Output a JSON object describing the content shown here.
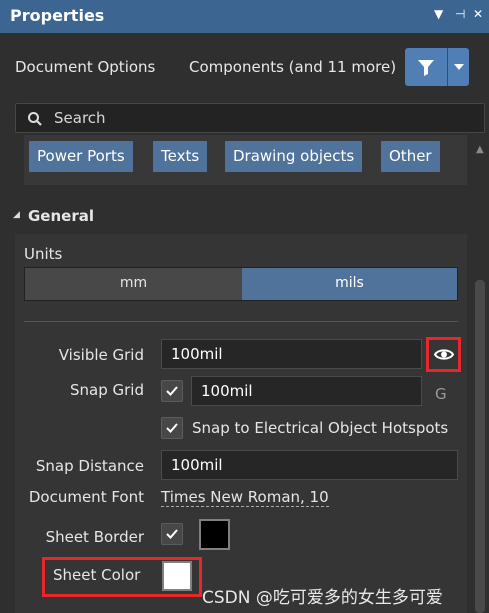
{
  "panel": {
    "title": "Properties",
    "title_buttons": [
      "▼",
      "⊣",
      "✕"
    ]
  },
  "tabs": {
    "document_options": "Document Options",
    "components": "Components (and 11 more)"
  },
  "search": {
    "placeholder": "Search"
  },
  "filters": [
    "Power Ports",
    "Texts",
    "Drawing objects",
    "Other"
  ],
  "general": {
    "heading": "General",
    "units_label": "Units",
    "units": {
      "mm": "mm",
      "mils": "mils",
      "selected": "mils"
    },
    "visible_grid_label": "Visible Grid",
    "visible_grid_value": "100mil",
    "snap_grid_label": "Snap Grid",
    "snap_grid_value": "100mil",
    "snap_grid_shortcut": "G",
    "snap_electrical_label": "Snap to Electrical Object Hotspots",
    "snap_distance_label": "Snap Distance",
    "snap_distance_value": "100mil",
    "document_font_label": "Document Font",
    "document_font_value": "Times New Roman, 10",
    "sheet_border_label": "Sheet Border",
    "sheet_color_label": "Sheet Color"
  },
  "watermark": "CSDN @吃可爱多的女生多可爱",
  "colors": {
    "title_bar": "#3c6591",
    "accent": "#50739b",
    "highlight": "#e8272b",
    "sheet_border_color": "#000000",
    "sheet_color": "#ffffff"
  },
  "icons": {
    "search": "search-icon",
    "filter": "filter-icon",
    "visibility": "eye-icon",
    "check": "checkmark-icon",
    "collapse": "triangle-down-icon"
  }
}
